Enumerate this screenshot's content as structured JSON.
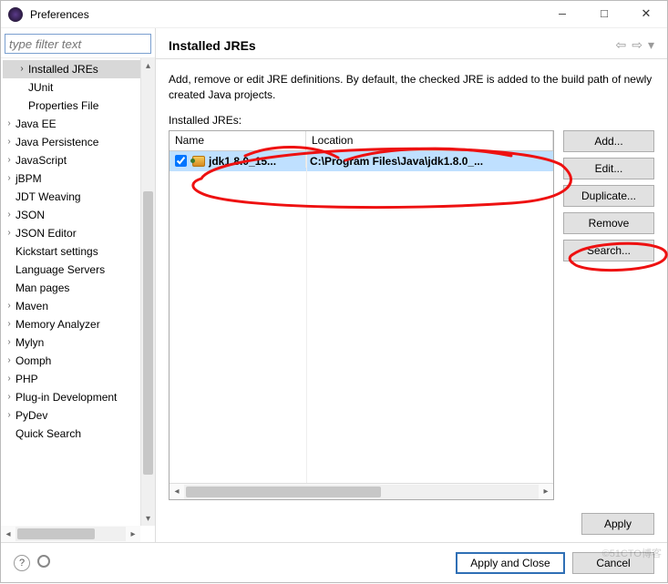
{
  "window": {
    "title": "Preferences"
  },
  "filter": {
    "placeholder": "type filter text"
  },
  "tree": [
    {
      "label": "Installed JREs",
      "level": 1,
      "expandable": true,
      "selected": true
    },
    {
      "label": "JUnit",
      "level": 1,
      "expandable": false
    },
    {
      "label": "Properties File",
      "level": 1,
      "expandable": false
    },
    {
      "label": "Java EE",
      "level": 0,
      "expandable": true
    },
    {
      "label": "Java Persistence",
      "level": 0,
      "expandable": true
    },
    {
      "label": "JavaScript",
      "level": 0,
      "expandable": true
    },
    {
      "label": "jBPM",
      "level": 0,
      "expandable": true
    },
    {
      "label": "JDT Weaving",
      "level": 0,
      "expandable": false
    },
    {
      "label": "JSON",
      "level": 0,
      "expandable": true
    },
    {
      "label": "JSON Editor",
      "level": 0,
      "expandable": true
    },
    {
      "label": "Kickstart settings",
      "level": 0,
      "expandable": false
    },
    {
      "label": "Language Servers",
      "level": 0,
      "expandable": false
    },
    {
      "label": "Man pages",
      "level": 0,
      "expandable": false
    },
    {
      "label": "Maven",
      "level": 0,
      "expandable": true
    },
    {
      "label": "Memory Analyzer",
      "level": 0,
      "expandable": true
    },
    {
      "label": "Mylyn",
      "level": 0,
      "expandable": true
    },
    {
      "label": "Oomph",
      "level": 0,
      "expandable": true
    },
    {
      "label": "PHP",
      "level": 0,
      "expandable": true
    },
    {
      "label": "Plug-in Development",
      "level": 0,
      "expandable": true
    },
    {
      "label": "PyDev",
      "level": 0,
      "expandable": true
    },
    {
      "label": "Quick Search",
      "level": 0,
      "expandable": false
    }
  ],
  "page": {
    "heading": "Installed JREs",
    "description": "Add, remove or edit JRE definitions. By default, the checked JRE is added to the build path of newly created Java projects.",
    "tableLabel": "Installed JREs:",
    "columns": {
      "name": "Name",
      "location": "Location"
    },
    "rows": [
      {
        "checked": true,
        "name": "jdk1.8.0_15...",
        "location": "C:\\Program Files\\Java\\jdk1.8.0_..."
      }
    ]
  },
  "buttons": {
    "add": "Add...",
    "edit": "Edit...",
    "duplicate": "Duplicate...",
    "remove": "Remove",
    "search": "Search...",
    "apply": "Apply",
    "applyClose": "Apply and Close",
    "cancel": "Cancel"
  },
  "watermark": "©51CTO博客"
}
